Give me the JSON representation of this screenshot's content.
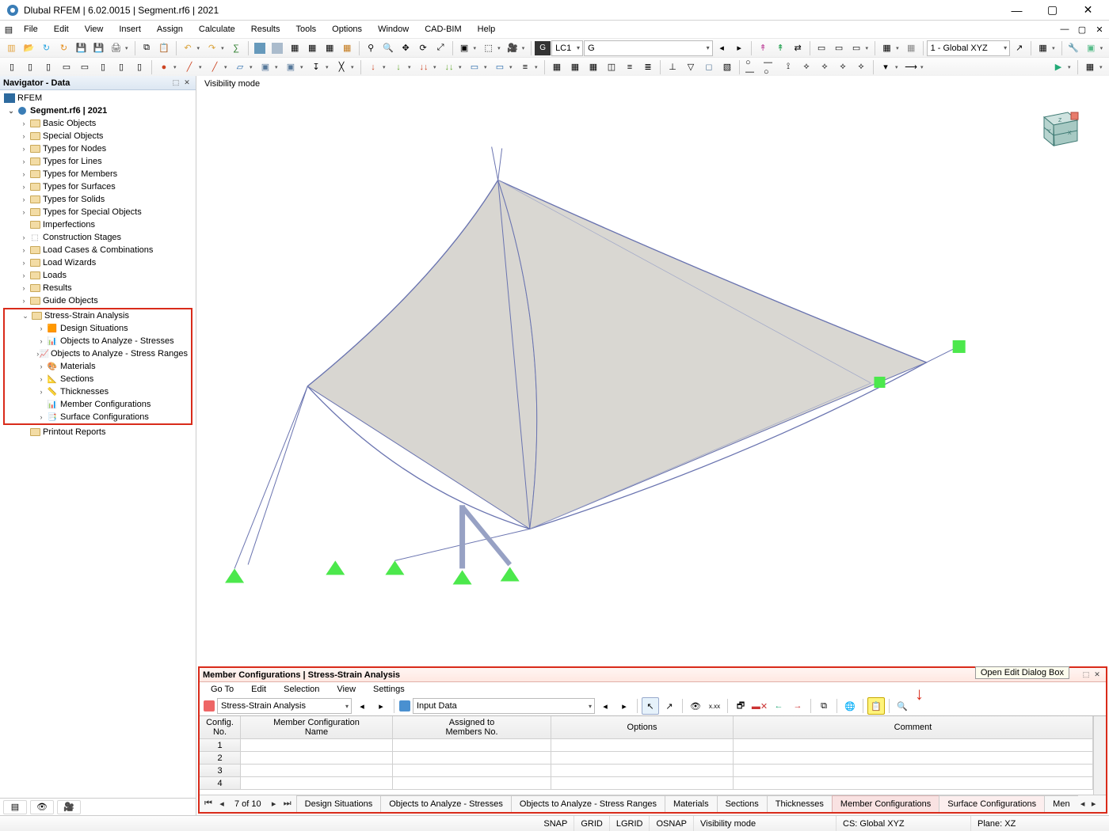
{
  "titlebar": {
    "title": "Dlubal RFEM | 6.02.0015 | Segment.rf6 | 2021"
  },
  "menubar": {
    "items": [
      "File",
      "Edit",
      "View",
      "Insert",
      "Assign",
      "Calculate",
      "Results",
      "Tools",
      "Options",
      "Window",
      "CAD-BIM",
      "Help"
    ]
  },
  "toolbar1": {
    "lc_label": "G",
    "lc_code": "LC1",
    "lc_name": "G",
    "cs_label": "1 - Global XYZ"
  },
  "navigator": {
    "title": "Navigator - Data",
    "root": "RFEM",
    "file": "Segment.rf6 | 2021",
    "items1": [
      "Basic Objects",
      "Special Objects",
      "Types for Nodes",
      "Types for Lines",
      "Types for Members",
      "Types for Surfaces",
      "Types for Solids",
      "Types for Special Objects",
      "Imperfections",
      "Construction Stages",
      "Load Cases & Combinations",
      "Load Wizards",
      "Loads",
      "Results",
      "Guide Objects"
    ],
    "stress_strain": {
      "label": "Stress-Strain Analysis",
      "children": [
        "Design Situations",
        "Objects to Analyze - Stresses",
        "Objects to Analyze - Stress Ranges",
        "Materials",
        "Sections",
        "Thicknesses",
        "Member Configurations",
        "Surface Configurations"
      ]
    },
    "items2": [
      "Printout Reports"
    ]
  },
  "viewport": {
    "info": "Visibility mode"
  },
  "table_panel": {
    "title": "Member Configurations | Stress-Strain Analysis",
    "tooltip": "Open Edit Dialog Box",
    "menubar": [
      "Go To",
      "Edit",
      "Selection",
      "View",
      "Settings"
    ],
    "combo1": "Stress-Strain Analysis",
    "combo2": "Input Data",
    "columns": {
      "c0a": "Config.",
      "c0b": "No.",
      "c1a": "Member Configuration",
      "c1b": "Name",
      "c2a": "Assigned to",
      "c2b": "Members No.",
      "c3": "Options",
      "c4": "Comment"
    },
    "rows": [
      "1",
      "2",
      "3",
      "4"
    ],
    "page_indicator": "7 of 10",
    "footer_tabs": [
      "Design Situations",
      "Objects to Analyze - Stresses",
      "Objects to Analyze - Stress Ranges",
      "Materials",
      "Sections",
      "Thicknesses",
      "Member Configurations",
      "Surface Configurations",
      "Men"
    ]
  },
  "statusbar": {
    "snap": "SNAP",
    "grid": "GRID",
    "lgrid": "LGRID",
    "osnap": "OSNAP",
    "vis": "Visibility mode",
    "cs": "CS: Global XYZ",
    "plane": "Plane: XZ"
  }
}
